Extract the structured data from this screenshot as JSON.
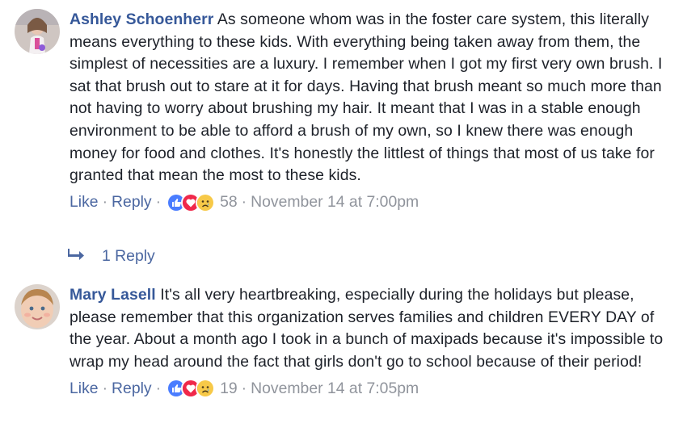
{
  "comments": [
    {
      "author": "Ashley Schoenherr",
      "text": "As someone whom was in the foster care system, this literally means everything to these kids. With everything being taken away from them, the simplest of necessities are a luxury. I remember when I got my first very own brush. I sat that brush out to stare at it for days. Having that brush meant so much more than not having to worry about brushing my hair. It meant that I was in a stable enough environment to be able to afford a brush of my own, so I knew there was enough money for food and clothes. It's honestly the littlest of things that most of us take for granted that mean the most to these kids.",
      "like_label": "Like",
      "reply_label": "Reply",
      "reaction_count": "58",
      "timestamp": "November 14 at 7:00pm",
      "reactions": [
        "like-icon",
        "love-icon",
        "sad-icon"
      ]
    },
    {
      "author": "Mary Lasell",
      "text": "It's all very heartbreaking, especially during the holidays but please, please remember that this organization serves families and children EVERY DAY of the year. About a month ago I took in a bunch of maxipads because it's impossible to wrap my head around the fact that girls don't go to school because of their period!",
      "like_label": "Like",
      "reply_label": "Reply",
      "reaction_count": "19",
      "timestamp": "November 14 at 7:05pm",
      "reactions": [
        "like-icon",
        "love-icon",
        "sad-icon"
      ]
    }
  ],
  "replies_link": "1 Reply",
  "separator": "·",
  "colors": {
    "author": "#365899",
    "action_link": "#4b67a1",
    "meta": "#90949c",
    "text": "#1d2129",
    "like": "#4a7dff",
    "love": "#f0284a",
    "sad": "#f7c948"
  }
}
